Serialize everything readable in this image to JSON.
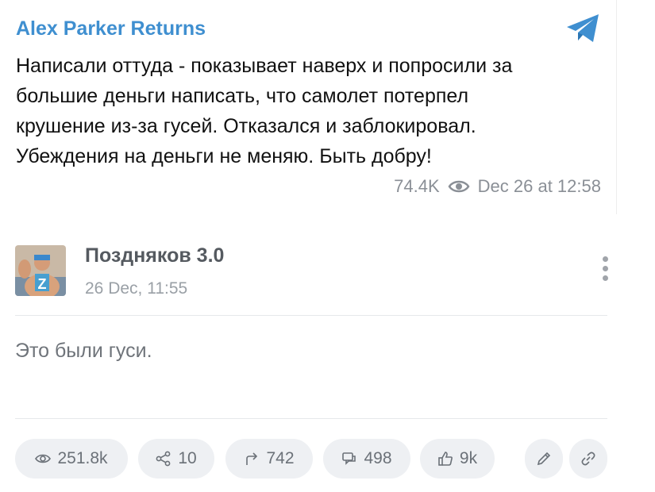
{
  "post": {
    "channel": "Alex Parker Returns",
    "text": "Написали оттуда - показывает наверх и попросили за\nбольшие деньги написать, что самолет потерпел\nкрушение из-за гусей. Отказался и заблокировал.\nУбеждения на деньги не меняю. Быть добру!",
    "views": "74.4K",
    "date": "Dec 26 at 12:58"
  },
  "comment_card": {
    "author": "Поздняков 3.0",
    "date": "26 Dec, 11:55",
    "avatar_letter": "Z",
    "text": "Это были гуси."
  },
  "stats": {
    "views": "251.8k",
    "shares": "10",
    "reposts": "742",
    "comments": "498",
    "likes": "9k"
  },
  "colors": {
    "accent": "#3f8fd0",
    "pill_bg": "#eef0f3"
  },
  "icons": [
    "telegram-icon",
    "eye-icon",
    "more-vertical-icon",
    "share-icon",
    "repost-icon",
    "comments-icon",
    "thumbs-up-icon",
    "pencil-icon",
    "link-icon"
  ]
}
